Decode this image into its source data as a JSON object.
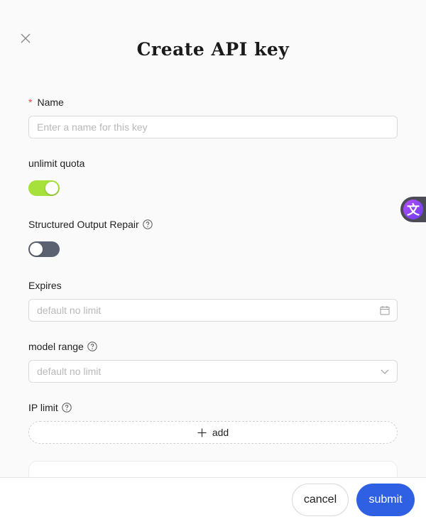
{
  "dialog": {
    "title": "Create API key"
  },
  "form": {
    "name": {
      "required_mark": "*",
      "label": "Name",
      "placeholder": "Enter a name for this key",
      "value": ""
    },
    "unlimit_quota": {
      "label": "unlimit quota",
      "checked": true
    },
    "structured_output_repair": {
      "label": "Structured Output Repair",
      "checked": false
    },
    "expires": {
      "label": "Expires",
      "placeholder": "default no limit"
    },
    "model_range": {
      "label": "model range",
      "placeholder": "default no limit"
    },
    "ip_limit": {
      "label": "IP limit",
      "add_label": "add"
    }
  },
  "footer": {
    "cancel_label": "cancel",
    "submit_label": "submit"
  },
  "colors": {
    "toggle_on": "#a6e03a",
    "toggle_off": "#5b6170",
    "primary": "#2f5fe3",
    "required": "#e5484d"
  },
  "icons": [
    "close-icon",
    "help-icon",
    "calendar-icon",
    "chevron-down-icon",
    "plus-icon",
    "translate-widget-icon"
  ]
}
